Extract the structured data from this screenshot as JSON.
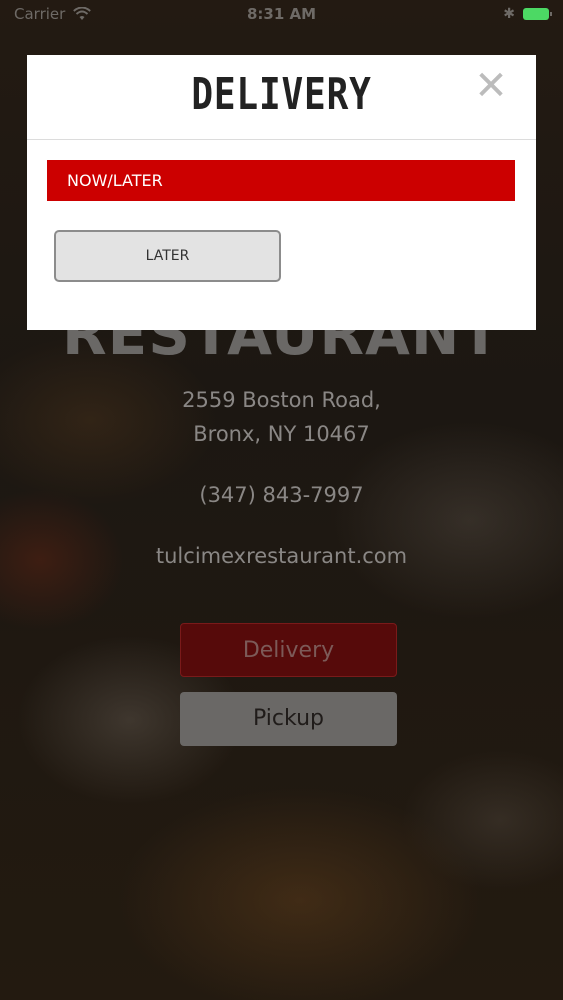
{
  "status_bar": {
    "carrier": "Carrier",
    "time": "8:31 AM",
    "icons": [
      "wifi-icon",
      "bluetooth-icon",
      "battery-icon"
    ],
    "battery_color": "#4cd964"
  },
  "restaurant": {
    "name": "RESTAURANT",
    "address_line1": "2559 Boston Road,",
    "address_line2": "Bronx, NY 10467",
    "phone": "(347) 843-7997",
    "website": "tulcimexrestaurant.com"
  },
  "actions": {
    "delivery_label": "Delivery",
    "pickup_label": "Pickup"
  },
  "modal": {
    "title": "DELIVERY",
    "close_icon": "close-icon",
    "section_label": "NOW/LATER",
    "later_label": "LATER",
    "accent_color": "#cc0000"
  }
}
